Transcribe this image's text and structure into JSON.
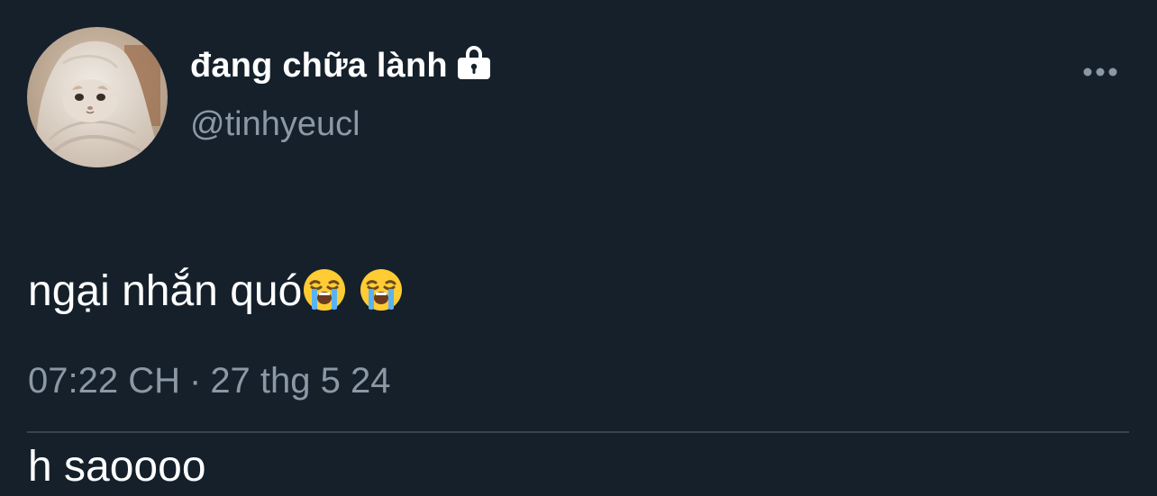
{
  "user": {
    "display_name": "đang chữa lành",
    "handle": "@tinhyeucl",
    "protected_icon": "lock-icon",
    "avatar": "cat-in-blanket-avatar"
  },
  "tweet": {
    "text_part1": "ngại nhắn quó",
    "emoji": "loudly-crying-face",
    "line2": "h saoooo",
    "time": "07:22 CH",
    "separator": "·",
    "date": "27 thg 5 24"
  },
  "actions": {
    "more_icon": "more-horizontal-icon"
  },
  "colors": {
    "background": "#15202b",
    "primary_text": "#ffffff",
    "secondary_text": "#8b98a5",
    "divider": "#38444d"
  }
}
